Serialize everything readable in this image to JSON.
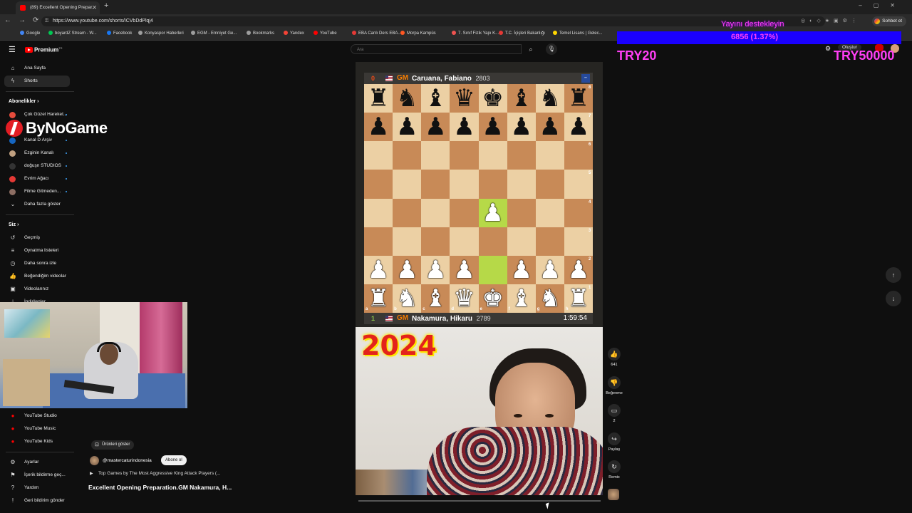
{
  "browser": {
    "tab_title": "(89) Excellent Opening Prepar...",
    "url": "https://www.youtube.com/shorts/ICVbDdPlqj4",
    "profile_label": "Sohbet et",
    "bookmarks": [
      "Google",
      "boyardZ Stream - W...",
      "Facebook",
      "Konyaspor Haberleri",
      "EGM - Emniyet Ge...",
      "Bookmarks",
      "Yandex",
      "YouTube",
      "EBA Canlı Ders EBA...",
      "Morpa Kampüs",
      "7. Sınıf Fizik Yapı K...",
      "T.C. İçişleri Bakanlığı",
      "Temel Lisans | Gelec..."
    ],
    "bookmark_colors": [
      "#4285f4",
      "#00c853",
      "#1877f2",
      "#9e9e9e",
      "#9e9e9e",
      "#9e9e9e",
      "#f44336",
      "#ff0000",
      "#e53935",
      "#ff5722",
      "#ef5350",
      "#e53935",
      "#ffd600"
    ]
  },
  "youtube": {
    "logo": "Premium",
    "logo_sup": "TR",
    "search_placeholder": "Ara",
    "create_label": "Oluştur",
    "sidebar": {
      "home": "Ana Sayfa",
      "shorts": "Shorts",
      "subscriptions_header": "Abonelikler",
      "subscriptions": [
        {
          "name": "Çok Güzel Hareket...",
          "color": "#e74c3c"
        },
        {
          "name": "",
          "color": "#888888"
        },
        {
          "name": "Kanal D Arşiv",
          "color": "#1565c0"
        },
        {
          "name": "Ezginin Kanalı",
          "color": "#c0a080"
        },
        {
          "name": "doğuşn STUDIOS",
          "color": "#333333"
        },
        {
          "name": "Evrim Ağacı",
          "color": "#e53935"
        },
        {
          "name": "Filme Gitmeden...",
          "color": "#8d6e63"
        }
      ],
      "show_more": "Daha fazla göster",
      "you_header": "Siz",
      "you_items": [
        {
          "label": "Geçmiş",
          "icon": "↺"
        },
        {
          "label": "Oynatma listeleri",
          "icon": "≡"
        },
        {
          "label": "Daha sonra izle",
          "icon": "◷"
        },
        {
          "label": "Beğendiğim videolar",
          "icon": "👍"
        },
        {
          "label": "Videolarınız",
          "icon": "▣"
        },
        {
          "label": "İndirilenler",
          "icon": "⤓"
        }
      ],
      "more_items": [
        {
          "label": "YouTube Studio",
          "color": "#ff0000"
        },
        {
          "label": "YouTube Music",
          "color": "#ff0000"
        },
        {
          "label": "YouTube Kids",
          "color": "#ff0000"
        }
      ],
      "footer_items": [
        {
          "label": "Ayarlar",
          "icon": "⚙"
        },
        {
          "label": "İçerik bildirme geç...",
          "icon": "⚑"
        },
        {
          "label": "Yardım",
          "icon": "?"
        },
        {
          "label": "Geri bildirim gönder",
          "icon": "!"
        }
      ]
    },
    "overlay_brand": "ByNoGame",
    "short": {
      "products_label": "Ürünleri göster",
      "channel": "@mastercaturindonesia",
      "subscribe_label": "Abone ol",
      "playlist": "Top Games by The Most  Aggressive King Attack Players (...",
      "title": "Excellent Opening Preparation.GM Nakamura, H...",
      "progress_fraction": 0.0,
      "top_player": {
        "score": "0",
        "title": "GM",
        "name": "Caruana, Fabiano",
        "rating": "2803"
      },
      "bottom_player": {
        "score": "1",
        "title": "GM",
        "name": "Nakamura, Hikaru",
        "rating": "2789",
        "clock": "1:59:54"
      },
      "board": [
        [
          "br",
          "bn",
          "bb",
          "bq",
          "bk",
          "bb",
          "bn",
          "br"
        ],
        [
          "bp",
          "bp",
          "bp",
          "bp",
          "bp",
          "bp",
          "bp",
          "bp"
        ],
        [
          "",
          "",
          "",
          "",
          "",
          "",
          "",
          ""
        ],
        [
          "",
          "",
          "",
          "",
          "",
          "",
          "",
          ""
        ],
        [
          "",
          "",
          "",
          "",
          "wp",
          "",
          "",
          ""
        ],
        [
          "",
          "",
          "",
          "",
          "",
          "",
          "",
          ""
        ],
        [
          "wp",
          "wp",
          "wp",
          "wp",
          "",
          "wp",
          "wp",
          "wp"
        ],
        [
          "wr",
          "wn",
          "wb",
          "wq",
          "wk",
          "wb",
          "wn",
          "wr"
        ]
      ],
      "highlighted_squares": [
        "e2",
        "e4"
      ],
      "rank_labels": [
        "8",
        "7",
        "6",
        "5",
        "4",
        "3",
        "2",
        "1"
      ],
      "file_labels": [
        "a",
        "b",
        "c",
        "d",
        "e",
        "f",
        "g",
        "h"
      ],
      "year_overlay": "2024",
      "likes": "641",
      "dislike_label": "Beğenme",
      "comments": "2",
      "share_label": "Paylaş",
      "remix_label": "Remix"
    }
  },
  "stream_overlay": {
    "donate_label": "Yayını destekleyin",
    "donate_amount": "6856 (1.37%)",
    "left_code": "TRY20",
    "right_code": "TRY50000"
  }
}
